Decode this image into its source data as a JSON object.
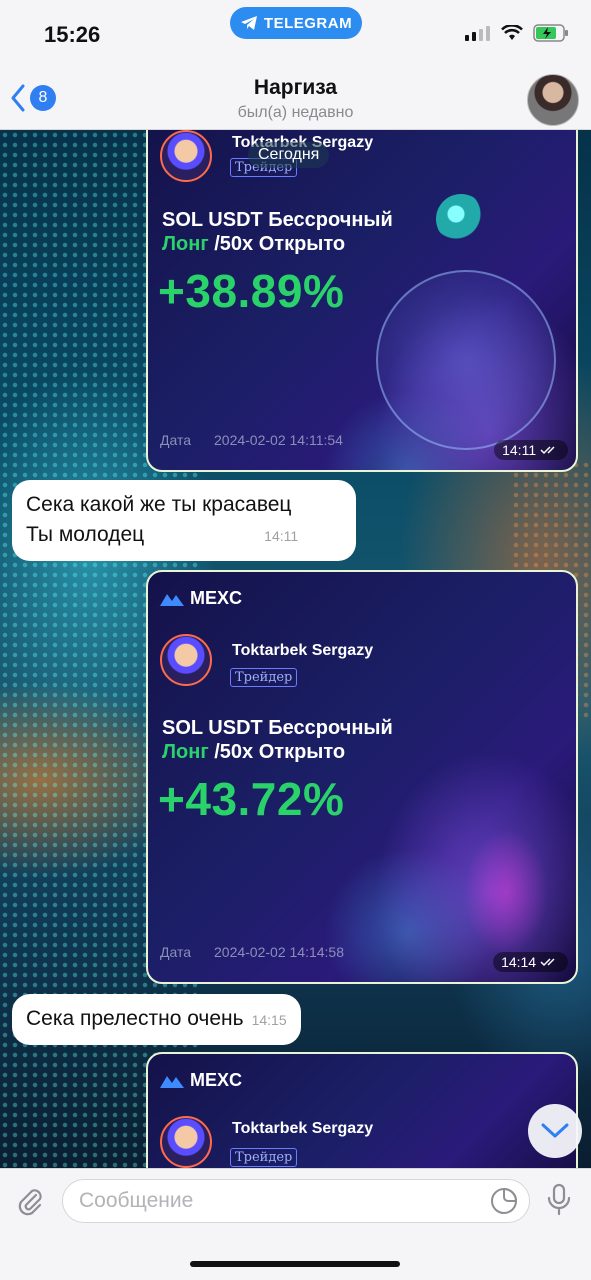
{
  "status": {
    "time": "15:26",
    "app_pill": "TELEGRAM"
  },
  "header": {
    "back_count": "8",
    "title": "Наргиза",
    "subtitle": "был(а) недавно"
  },
  "date_separator": "Сегодня",
  "messages": [
    {
      "type": "image",
      "brand": "",
      "trader": "Toktarbek Sergazy",
      "trader_tag": "Трейдер",
      "pair_line1": "SOL USDT Бессрочный",
      "pair_long": "Лонг",
      "pair_rest": " /50x Открыто",
      "pnl": "+38.89%",
      "date_label": "Дата",
      "date_value": "2024-02-02 14:11:54",
      "time": "14:11"
    },
    {
      "type": "text",
      "line1": "Сека какой же ты красавец",
      "line2": "Ты молодец",
      "time": "14:11"
    },
    {
      "type": "image",
      "brand": "MEXC",
      "trader": "Toktarbek Sergazy",
      "trader_tag": "Трейдер",
      "pair_line1": "SOL USDT Бессрочный",
      "pair_long": "Лонг",
      "pair_rest": " /50x Открыто",
      "pnl": "+43.72%",
      "date_label": "Дата",
      "date_value": "2024-02-02 14:14:58",
      "time": "14:14"
    },
    {
      "type": "text",
      "line1": "Сека прелестно очень",
      "time": "14:15"
    },
    {
      "type": "image",
      "brand": "MEXC",
      "trader": "Toktarbek Sergazy",
      "trader_tag": "Трейдер"
    }
  ],
  "input": {
    "placeholder": "Сообщение"
  },
  "colors": {
    "accent": "#2f7ff2",
    "pnl_green": "#2ad36a",
    "card_border": "#e9f4d6"
  }
}
